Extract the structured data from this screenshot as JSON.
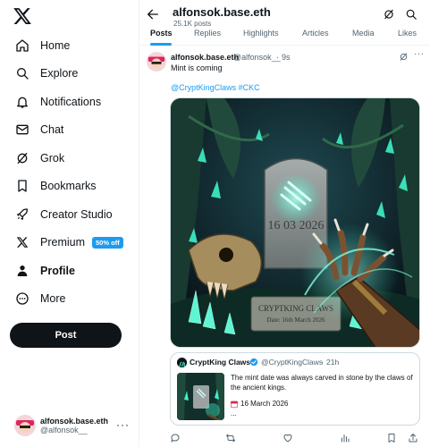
{
  "sidebar": {
    "items": [
      {
        "label": "Home",
        "icon": "home-icon"
      },
      {
        "label": "Explore",
        "icon": "search-icon"
      },
      {
        "label": "Notifications",
        "icon": "bell-icon"
      },
      {
        "label": "Chat",
        "icon": "envelope-icon"
      },
      {
        "label": "Grok",
        "icon": "grok-icon"
      },
      {
        "label": "Bookmarks",
        "icon": "bookmark-icon"
      },
      {
        "label": "Creator Studio",
        "icon": "rocket-icon"
      },
      {
        "label": "Premium",
        "icon": "x-icon",
        "badge": "50% off"
      },
      {
        "label": "Profile",
        "icon": "person-icon",
        "active": true
      },
      {
        "label": "More",
        "icon": "more-circle-icon"
      }
    ],
    "post_label": "Post",
    "account": {
      "name": "alfonsok.base.eth",
      "handle": "@alfonsok__"
    }
  },
  "header": {
    "title": "alfonsok.base.eth",
    "subtitle": "25.1K posts",
    "tabs": [
      "Posts",
      "Replies",
      "Highlights",
      "Articles",
      "Media",
      "Likes"
    ]
  },
  "tweet": {
    "name": "alfonsok.base.eth",
    "handle": "@alfonsok__",
    "separator": "·",
    "time": "9s",
    "text": "Mint is coming",
    "mention": "@CryptKingClaws",
    "hashtag": "#CKC",
    "image_text": {
      "date": "16 03 2026",
      "plaque_title": "CRYPTKING CLAWS",
      "plaque_date": "Date: 16th March 2026"
    },
    "quote": {
      "name": "CryptKing Claws",
      "handle": "@CryptKingClaws",
      "separator": "·",
      "time": "21h",
      "text": "The mint date was always carved in stone by the claws of the ancient kings.",
      "date": "16 March 2026",
      "ellipsis": "..."
    }
  },
  "colors": {
    "accent": "#1d9bf0",
    "text": "#0f1419",
    "muted": "#536471",
    "border": "#eff3f4",
    "glow": "#3ff0c8"
  }
}
